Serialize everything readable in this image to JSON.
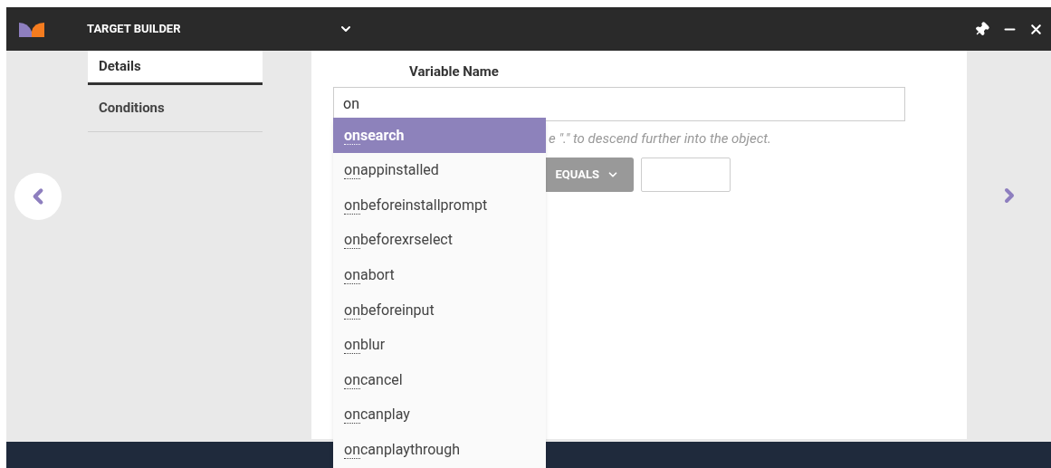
{
  "window": {
    "title": "TARGET BUILDER"
  },
  "tabs": [
    {
      "label": "Details",
      "selected": true
    },
    {
      "label": "Conditions",
      "selected": false
    }
  ],
  "variable": {
    "label": "Variable Name",
    "value": "on",
    "hint": "e \".\" to descend further into the object.",
    "operator": "EQUALS"
  },
  "suggestions": [
    {
      "label": "onsearch",
      "selected": true
    },
    {
      "label": "onappinstalled",
      "selected": false
    },
    {
      "label": "onbeforeinstallprompt",
      "selected": false
    },
    {
      "label": "onbeforexrselect",
      "selected": false
    },
    {
      "label": "onabort",
      "selected": false
    },
    {
      "label": "onbeforeinput",
      "selected": false
    },
    {
      "label": "onblur",
      "selected": false
    },
    {
      "label": "oncancel",
      "selected": false
    },
    {
      "label": "oncanplay",
      "selected": false
    },
    {
      "label": "oncanplaythrough",
      "selected": false
    }
  ]
}
